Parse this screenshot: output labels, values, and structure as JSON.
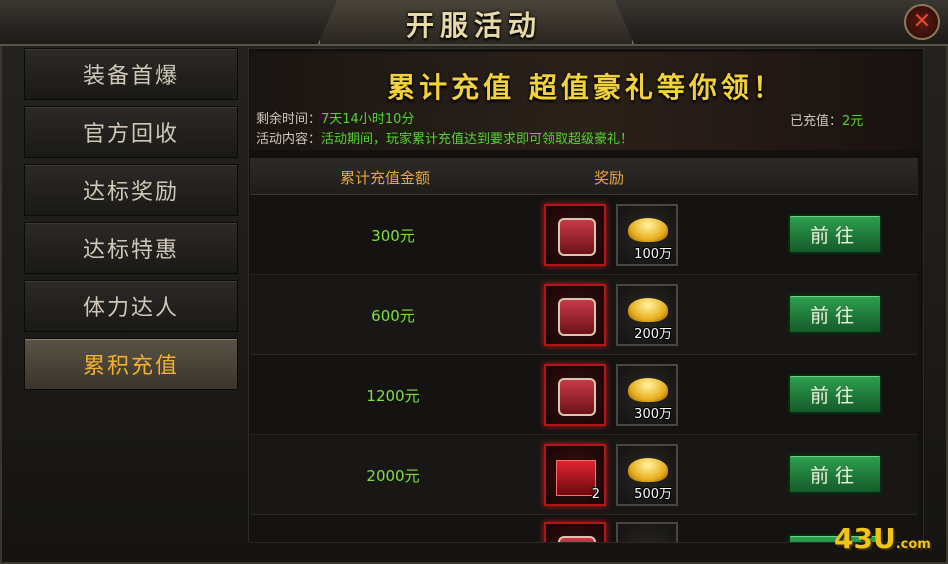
{
  "window": {
    "title": "开服活动",
    "close_symbol": "✕"
  },
  "sidebar": {
    "items": [
      {
        "label": "装备首爆",
        "active": false
      },
      {
        "label": "官方回收",
        "active": false
      },
      {
        "label": "达标奖励",
        "active": false
      },
      {
        "label": "达标特惠",
        "active": false
      },
      {
        "label": "体力达人",
        "active": false
      },
      {
        "label": "累积充值",
        "active": true
      }
    ]
  },
  "banner": {
    "title": "累计充值  超值豪礼等你领！",
    "remaining_label": "剩余时间：",
    "remaining_value": "7天14小时10分",
    "content_label": "活动内容：",
    "content_value": "活动期间，玩家累计充值达到要求即可领取超级豪礼！",
    "recharged_label": "已充值：",
    "recharged_value": "2元"
  },
  "table": {
    "headers": {
      "amount": "累计充值金额",
      "reward": "奖励"
    },
    "rows": [
      {
        "amount": "300元",
        "item_icon": "treasure-chest-icon",
        "item_qty": "",
        "gold_icon": "gold-ingot-icon",
        "gold_qty": "100万",
        "button": "前往"
      },
      {
        "amount": "600元",
        "item_icon": "treasure-chest-icon",
        "item_qty": "",
        "gold_icon": "gold-ingot-icon",
        "gold_qty": "200万",
        "button": "前往"
      },
      {
        "amount": "1200元",
        "item_icon": "treasure-chest-icon",
        "item_qty": "",
        "gold_icon": "gold-ingot-icon",
        "gold_qty": "300万",
        "button": "前往"
      },
      {
        "amount": "2000元",
        "item_icon": "red-gift-box-icon",
        "item_qty": "2",
        "gold_icon": "gold-ingot-icon",
        "gold_qty": "500万",
        "button": "前往"
      }
    ]
  },
  "watermark": {
    "brand": "43U",
    "domain": ".com"
  },
  "colors": {
    "accent_gold": "#f2d23a",
    "value_green": "#54d52e",
    "button_green": "#2fa050",
    "active_tab": "#f0b030"
  }
}
